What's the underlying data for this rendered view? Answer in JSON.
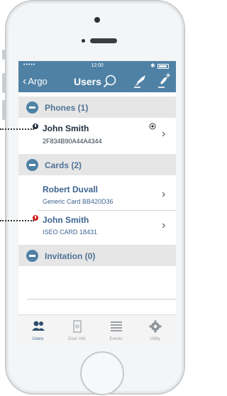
{
  "status_bar": {
    "signal": "•••••",
    "time": "12:00",
    "bluetooth": "✱"
  },
  "navbar": {
    "back_label": "Argo",
    "title": "Users",
    "icons": [
      "search-icon",
      "sign-icon",
      "add-user-icon"
    ]
  },
  "sections": [
    {
      "label": "Phones (1)"
    },
    {
      "label": "Cards (2)"
    },
    {
      "label": "Invitation (0)"
    }
  ],
  "phones": [
    {
      "name": "John Smith",
      "sub": "2F834B90A44A4344",
      "marker_color": "#1f2d3d",
      "has_key": true
    }
  ],
  "cards": [
    {
      "name": "Robert Duvall",
      "sub": "Generic Card BB420D36",
      "marker_color": "",
      "has_key": false
    },
    {
      "name": "John Smith",
      "sub": "ISEO CARD 18431",
      "marker_color": "#d21a1a",
      "has_key": false
    }
  ],
  "tabs": [
    {
      "label": "Users",
      "icon": "users-icon",
      "active": true
    },
    {
      "label": "Door Info",
      "icon": "door-info-icon",
      "active": false
    },
    {
      "label": "Events",
      "icon": "events-icon",
      "active": false
    },
    {
      "label": "Utility",
      "icon": "gear-icon",
      "active": false
    }
  ],
  "colors": {
    "accent": "#4f81a5",
    "section_bg": "#e6e6e6",
    "alert": "#d21a1a"
  }
}
